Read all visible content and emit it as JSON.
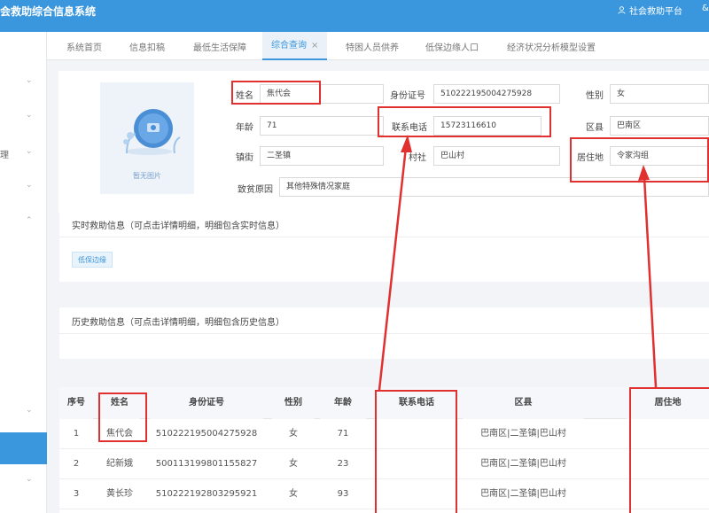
{
  "header": {
    "title": "会救助综合信息系统",
    "platform_label": "社会救助平台",
    "tail": "&"
  },
  "sidebar": {
    "text_item": "理",
    "chevrons": [
      "⌄",
      "⌄",
      "⌄",
      "⌄",
      "⌃",
      "⌄",
      "⌄"
    ]
  },
  "tabs": [
    {
      "label": "系统首页"
    },
    {
      "label": "信息扣稿"
    },
    {
      "label": "最低生活保障"
    },
    {
      "label": "综合查询",
      "active": true,
      "close": "×"
    },
    {
      "label": "特困人员供养"
    },
    {
      "label": "低保边缘人口"
    },
    {
      "label": "经济状况分析模型设置"
    }
  ],
  "photo": {
    "caption": "暂无图片"
  },
  "form": {
    "name": {
      "label": "姓名",
      "value": "焦代会"
    },
    "id_number": {
      "label": "身份证号",
      "value": "510222195004275928"
    },
    "gender": {
      "label": "性别",
      "value": "女"
    },
    "age": {
      "label": "年龄",
      "value": "71"
    },
    "phone": {
      "label": "联系电话",
      "value": "15723116610"
    },
    "district": {
      "label": "区县",
      "value": "巴南区"
    },
    "street": {
      "label": "镇街",
      "value": "二圣镇"
    },
    "village": {
      "label": "村社",
      "value": "巴山村"
    },
    "residence": {
      "label": "居住地",
      "value": "令家沟组"
    },
    "poverty_reason": {
      "label": "致贫原因",
      "value": "其他特殊情况家庭"
    }
  },
  "realtime_panel": {
    "title": "实时救助信息（可点击详情明细，明细包含实时信息）",
    "tag": "低保边缘"
  },
  "history_panel": {
    "title": "历史救助信息（可点击详情明细，明细包含历史信息）"
  },
  "table": {
    "columns": [
      "序号",
      "姓名",
      "身份证号",
      "性别",
      "年龄",
      "联系电话",
      "区县",
      "居住地"
    ],
    "rows": [
      [
        "1",
        "焦代会",
        "510222195004275928",
        "女",
        "71",
        "",
        "巴南区|二圣镇|巴山村",
        ""
      ],
      [
        "2",
        "纪新娥",
        "500113199801155827",
        "女",
        "23",
        "",
        "巴南区|二圣镇|巴山村",
        ""
      ],
      [
        "3",
        "黄长珍",
        "510222192803295921",
        "女",
        "93",
        "",
        "巴南区|二圣镇|巴山村",
        ""
      ]
    ]
  },
  "colors": {
    "header_blue": "#3a96dd",
    "annotation_red": "#e03030"
  }
}
